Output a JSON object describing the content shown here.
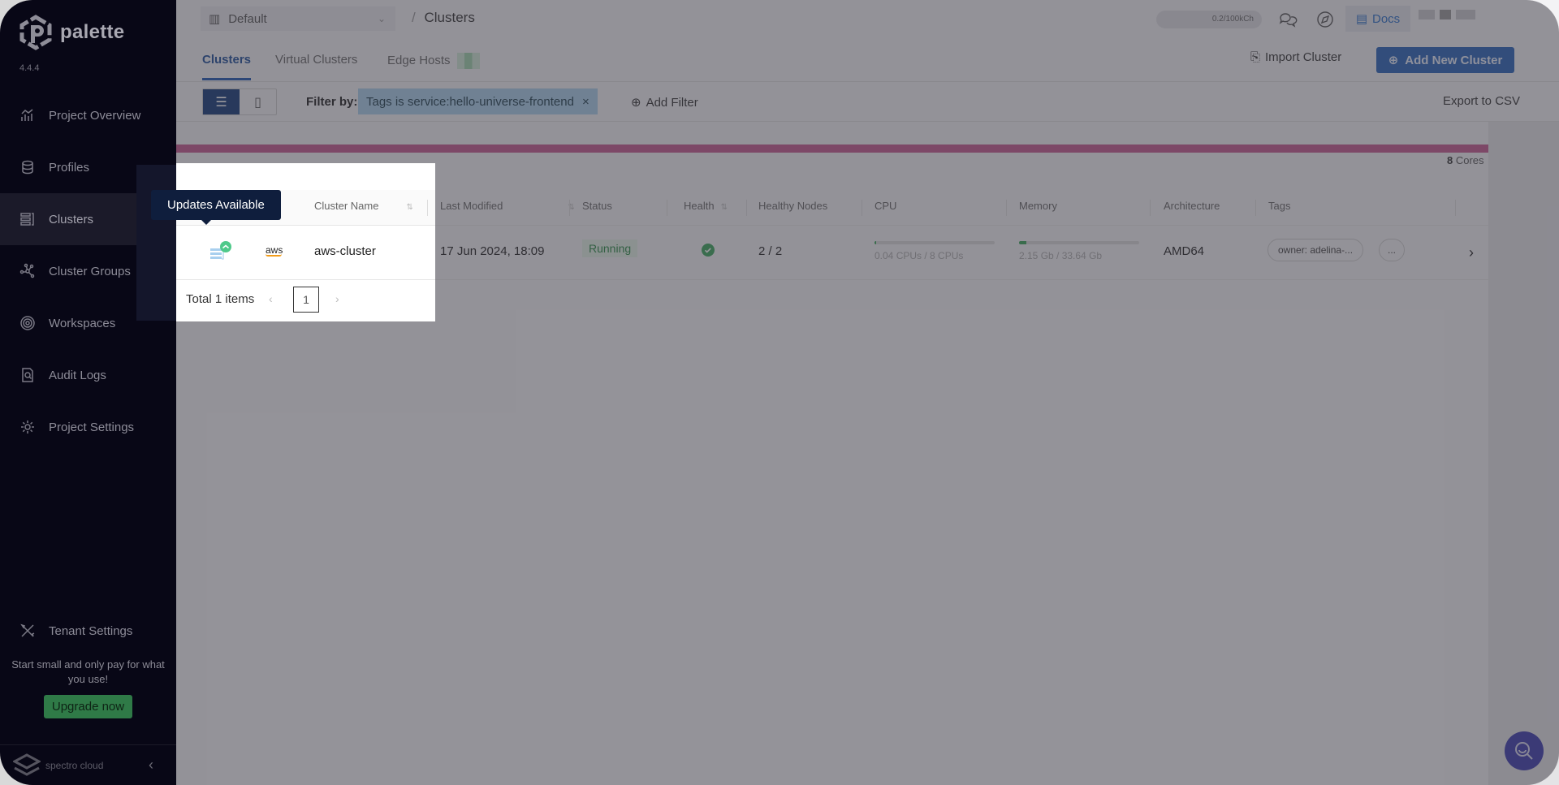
{
  "sidebar": {
    "brand": "palette",
    "version": "4.4.4",
    "items": [
      {
        "label": "Project Overview",
        "icon": "chart-icon"
      },
      {
        "label": "Profiles",
        "icon": "stack-icon"
      },
      {
        "label": "Clusters",
        "icon": "clusters-icon",
        "active": true
      },
      {
        "label": "Cluster Groups",
        "icon": "cluster-groups-icon"
      },
      {
        "label": "Workspaces",
        "icon": "workspaces-icon"
      },
      {
        "label": "Audit Logs",
        "icon": "audit-logs-icon"
      },
      {
        "label": "Project Settings",
        "icon": "gear-icon"
      }
    ],
    "tenant_settings": "Tenant Settings",
    "upgrade_text": "Start small and only pay for what you use!",
    "upgrade_button": "Upgrade now",
    "footer_brand": "spectro cloud"
  },
  "topbar": {
    "project": "Default",
    "breadcrumb_sep": "/",
    "breadcrumb": "Clusters",
    "credits": "0.2/100kCh",
    "docs": "Docs"
  },
  "tabs": [
    {
      "label": "Clusters",
      "active": true
    },
    {
      "label": "Virtual Clusters"
    },
    {
      "label": "Edge Hosts"
    }
  ],
  "actions": {
    "import": "Import Cluster",
    "add": "Add New Cluster",
    "export": "Export to CSV"
  },
  "filter": {
    "label": "Filter by:",
    "chip": "Tags is service:hello-universe-frontend",
    "add": "Add Filter"
  },
  "usage": {
    "cores_value": "8",
    "cores_label": "Cores"
  },
  "table": {
    "columns": [
      "Cluster Name",
      "Last Modified",
      "Status",
      "Health",
      "Healthy Nodes",
      "CPU",
      "Memory",
      "Architecture",
      "Tags"
    ],
    "rows": [
      {
        "cloud": "aws",
        "name": "aws-cluster",
        "last_modified": "17 Jun 2024, 18:09",
        "status": "Running",
        "health": "healthy",
        "healthy_nodes": "2 / 2",
        "cpu_label": "0.04 CPUs / 8 CPUs",
        "cpu_fraction": 0.005,
        "memory_label": "2.15 Gb / 33.64 Gb",
        "memory_fraction": 0.064,
        "architecture": "AMD64",
        "tags": [
          "owner: adelina-...",
          "..."
        ]
      }
    ]
  },
  "pagination": {
    "total": "Total 1 items",
    "page": "1"
  },
  "tooltip": "Updates Available",
  "colors": {
    "accent": "#2862b8",
    "status_running": "#2b8a46",
    "usage_bar": "#c4588f",
    "sidebar_bg": "#080716"
  }
}
